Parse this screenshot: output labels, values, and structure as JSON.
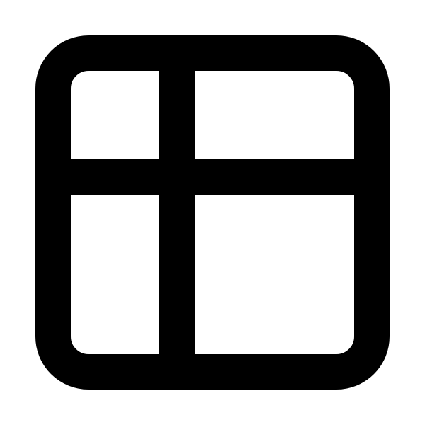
{
  "icon": {
    "name": "table-layout-icon",
    "color": "#000000",
    "background": "#ffffff"
  }
}
